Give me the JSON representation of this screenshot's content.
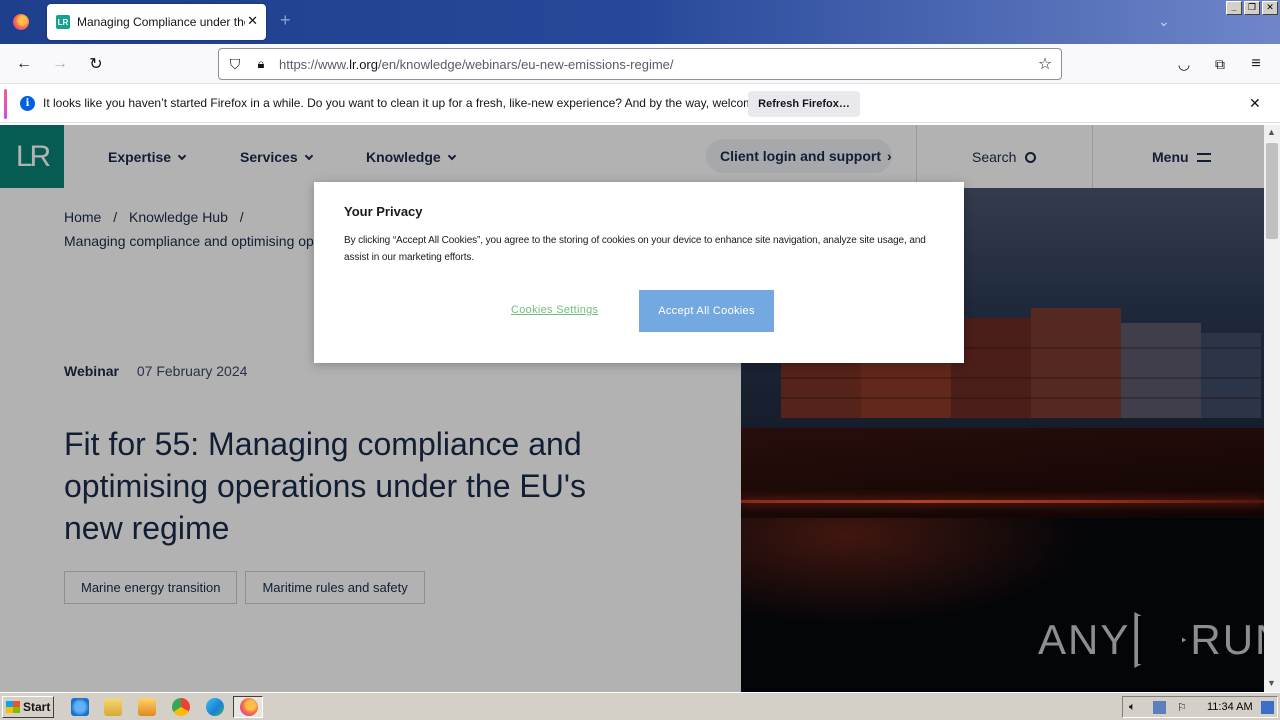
{
  "browser": {
    "tab_title": "Managing Compliance under the EU",
    "tab_favicon": "LR",
    "url_prefix": "https://www.",
    "url_domain": "lr.org",
    "url_path": "/en/knowledge/webinars/eu-new-emissions-regime/",
    "new_tab_symbol": "+",
    "close_symbol": "✕",
    "win_buttons": [
      "_",
      "❐",
      "✕"
    ]
  },
  "notification": {
    "text": "It looks like you haven’t started Firefox in a while. Do you want to clean it up for a fresh, like-new experience? And by the way, welcome back!",
    "refresh_label": "Refresh Firefox…",
    "info_glyph": "i",
    "close_symbol": "✕"
  },
  "site": {
    "logo_text": "LR",
    "nav": {
      "expertise": "Expertise",
      "services": "Services",
      "knowledge": "Knowledge",
      "client_login": "Client login and support",
      "search": "Search",
      "menu": "Menu"
    },
    "breadcrumb": {
      "home": "Home",
      "hub": "Knowledge Hub",
      "separator": "/",
      "current": "Managing compliance and optimising operations under the EU's new regime"
    },
    "meta": {
      "type": "Webinar",
      "date": "07 February 2024"
    },
    "title": "Fit for 55: Managing compliance and optimising operations under the EU's new regime",
    "tags": [
      "Marine energy transition",
      "Maritime rules and safety"
    ]
  },
  "privacy": {
    "title": "Your Privacy",
    "text": "By clicking “Accept All Cookies”, you agree to the storing of cookies on your device to enhance site navigation, analyze site usage, and assist in our marketing efforts.",
    "settings_label": "Cookies Settings",
    "accept_label": "Accept All Cookies"
  },
  "watermark": {
    "left": "ANY",
    "right": "RUN"
  },
  "taskbar": {
    "start_label": "Start",
    "time": "11:34 AM"
  },
  "colors": {
    "brand_teal": "#0a8577",
    "navy": "#1a2b4a",
    "accept_blue": "#74a8e0",
    "settings_green": "#6fbf7a"
  }
}
